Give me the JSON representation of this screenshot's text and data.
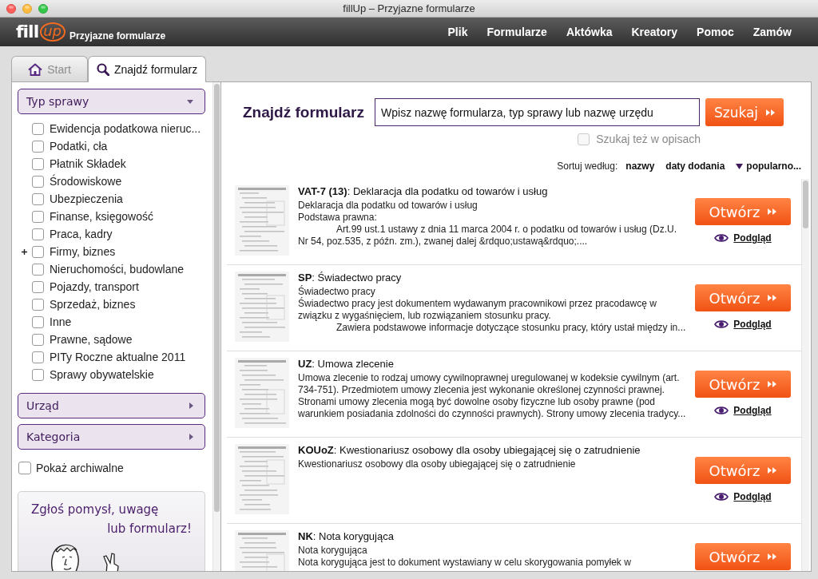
{
  "window": {
    "title": "fillUp – Przyjazne formularze"
  },
  "header": {
    "logo": {
      "main": "fill",
      "accent": "up"
    },
    "tagline": "Przyjazne formularze",
    "menu": [
      "Plik",
      "Formularze",
      "Aktówka",
      "Kreatory",
      "Pomoc",
      "Zamów"
    ]
  },
  "tabs": [
    {
      "label": "Start",
      "selected": false
    },
    {
      "label": "Znajdź formularz",
      "selected": true
    }
  ],
  "sidebar": {
    "filters": [
      {
        "title": "Typ sprawy",
        "expanded": true,
        "items": [
          {
            "label": "Ewidencja podatkowa nieruc...",
            "checked": false,
            "kind": "leaf"
          },
          {
            "label": "Podatki, cła",
            "checked": false,
            "kind": "leaf"
          },
          {
            "label": "Płatnik Składek",
            "checked": false,
            "kind": "leaf"
          },
          {
            "label": "Środowiskowe",
            "checked": false,
            "kind": "leaf"
          },
          {
            "label": "Ubezpieczenia",
            "checked": false,
            "kind": "leaf"
          },
          {
            "label": "Finanse, księgowość",
            "checked": false,
            "kind": "leaf"
          },
          {
            "label": "Praca, kadry",
            "checked": false,
            "kind": "leaf"
          },
          {
            "label": "Firmy, biznes",
            "checked": false,
            "kind": "group"
          },
          {
            "label": "Nieruchomości, budowlane",
            "checked": false,
            "kind": "leaf"
          },
          {
            "label": "Pojazdy, transport",
            "checked": false,
            "kind": "leaf"
          },
          {
            "label": "Sprzedaż, biznes",
            "checked": false,
            "kind": "leaf"
          },
          {
            "label": "Inne",
            "checked": false,
            "kind": "leaf"
          },
          {
            "label": "Prawne, sądowe",
            "checked": false,
            "kind": "leaf"
          },
          {
            "label": "PITy Roczne aktualne 2011",
            "checked": false,
            "kind": "leaf"
          },
          {
            "label": "Sprawy obywatelskie",
            "checked": false,
            "kind": "leaf"
          }
        ]
      },
      {
        "title": "Urząd",
        "expanded": false
      },
      {
        "title": "Kategoria",
        "expanded": false
      }
    ],
    "archive": {
      "label": "Pokaż archiwalne",
      "checked": false
    },
    "promo": {
      "lines": [
        "Zgłoś pomysł, uwagę",
        "lub formularz!"
      ]
    }
  },
  "search": {
    "heading": "Znajdź formularz",
    "placeholder": "Wpisz nazwę formularza, typ sprawy lub nazwę urzędu",
    "button": "Szukaj",
    "option": {
      "label": "Szukaj też w opisach",
      "checked": false,
      "disabled": true
    }
  },
  "sort": {
    "label": "Sortuj według:",
    "options": [
      {
        "label": "nazwy",
        "selected": false
      },
      {
        "label": "daty dodania",
        "selected": false
      },
      {
        "label": "popularno...",
        "selected": true
      }
    ]
  },
  "results": [
    {
      "title": "**VAT-7 (13)**: Deklaracja dla podatku od towarów i usług",
      "description": [
        {
          "kind": "plain",
          "text": "Deklaracja dla podatku od towarów i usług"
        },
        {
          "kind": "plain",
          "text": "Podstawa prawna:"
        },
        {
          "kind": "indented",
          "text": "Art.99 ust.1 ustawy z dnia 11 marca 2004 r. o podatku od towarów i usług (Dz.U. Nr 54, poz.535, z późn. zm.), zwanej dalej &rdquo;ustawą&rdquo;...."
        }
      ],
      "open_button": "Otwórz",
      "preview_link": "Podgląd"
    },
    {
      "title": "**SP**: Świadectwo pracy",
      "description": [
        {
          "kind": "plain",
          "text": "Świadectwo pracy"
        },
        {
          "kind": "plain",
          "text": "Świadectwo pracy jest dokumentem wydawanym pracownikowi przez pracodawcę w związku z wygaśnięciem, lub rozwiązaniem stosunku pracy."
        },
        {
          "kind": "indented",
          "text": "Zawiera podstawowe informacje dotyczące stosunku pracy, który ustał między in..."
        }
      ],
      "open_button": "Otwórz",
      "preview_link": "Podgląd"
    },
    {
      "title": "**UZ**: Umowa zlecenie",
      "description": [
        {
          "kind": "plain",
          "text": "Umowa zlecenie to rodzaj umowy cywilnoprawnej uregulowanej w kodeksie cywilnym (art. 734-751). Przedmiotem umowy zlecenia jest wykonanie określonej czynności prawnej. Stronami umowy zlecenia mogą być dowolne osoby fizyczne lub osoby prawne (pod warunkiem posiadania zdolności do czynności prawnych). Strony umowy zlecenia tradycy..."
        }
      ],
      "open_button": "Otwórz",
      "preview_link": "Podgląd"
    },
    {
      "title": "**KOUoZ**: Kwestionariusz osobowy dla osoby ubiegającej się o zatrudnienie",
      "description": [
        {
          "kind": "plain",
          "text": "Kwestionariusz osobowy dla osoby ubiegającej się o zatrudnienie"
        }
      ],
      "open_button": "Otwórz",
      "preview_link": "Podgląd"
    },
    {
      "title": "**NK**: Nota korygująca",
      "description": [
        {
          "kind": "plain",
          "text": "Nota korygująca"
        },
        {
          "kind": "plain",
          "text": "Nota korygująca jest to dokument wystawiany w celu skorygowania pomyłek w"
        }
      ],
      "open_button": "Otwórz"
    }
  ]
}
